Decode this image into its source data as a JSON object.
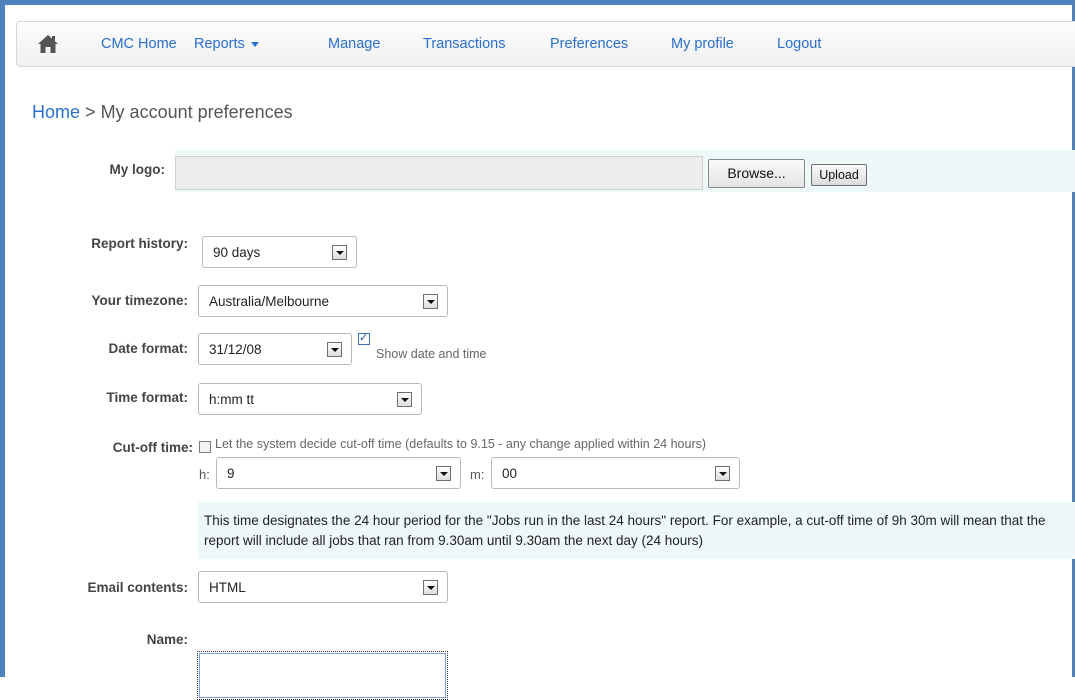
{
  "nav": {
    "home_icon": "home-icon",
    "items": [
      "CMC Home",
      "Reports",
      "Manage",
      "Transactions",
      "Preferences",
      "My profile",
      "Logout"
    ]
  },
  "breadcrumb": {
    "home": "Home",
    "separator": ">",
    "current": "My account preferences"
  },
  "logo": {
    "label": "My logo:",
    "browse": "Browse...",
    "upload": "Upload"
  },
  "report_history": {
    "label": "Report history:",
    "value": "90 days"
  },
  "timezone": {
    "label": "Your timezone:",
    "value": "Australia/Melbourne"
  },
  "date_format": {
    "label": "Date format:",
    "value": "31/12/08",
    "show_date_time_label": "Show date and time",
    "show_date_time_checked": true
  },
  "time_format": {
    "label": "Time format:",
    "value": "h:mm tt"
  },
  "cutoff": {
    "label": "Cut-off time:",
    "auto_label": "Let the system decide cut-off time (defaults to 9.15 - any change applied within 24 hours)",
    "auto_checked": false,
    "hour_label": "h:",
    "hour_value": "9",
    "minute_label": "m:",
    "minute_value": "00",
    "info": "This time designates the 24 hour period for the \"Jobs run in the last 24 hours\" report. For example, a cut-off time of 9h 30m will mean that the report will include all jobs that ran from 9.30am until 9.30am the next day (24 hours)"
  },
  "email_contents": {
    "label": "Email contents:",
    "value": "HTML"
  },
  "name": {
    "label": "Name:",
    "value": ""
  },
  "colors": {
    "link": "#2a6fc9",
    "info_bg": "#eef8f9",
    "frame": "#4f81bd"
  }
}
